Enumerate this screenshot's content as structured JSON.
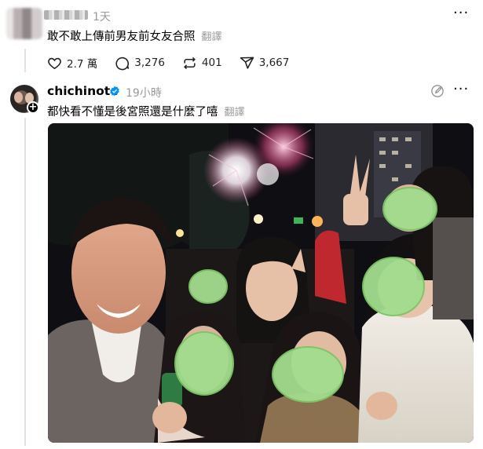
{
  "reply_post": {
    "time": "1天",
    "text": "敢不敢上傳前男友前女友合照",
    "translate_label": "翻譯",
    "more_label": "···"
  },
  "actions": {
    "likes": "2.7 萬",
    "comments": "3,276",
    "reposts": "401",
    "shares": "3,667"
  },
  "main_post": {
    "username": "chichinote",
    "time": "19小時",
    "text": "都快看不懂是後宮照還是什麼了嘻",
    "translate_label": "翻譯",
    "more_label": "···"
  },
  "colors": {
    "verified_blue": "#0095f6",
    "muted_text": "#999999",
    "face_blur_green": "#9bd98a"
  },
  "icons": [
    "heart-icon",
    "comment-icon",
    "repost-icon",
    "share-icon",
    "verified-icon",
    "edit-icon",
    "more-icon",
    "follow-plus-icon"
  ]
}
